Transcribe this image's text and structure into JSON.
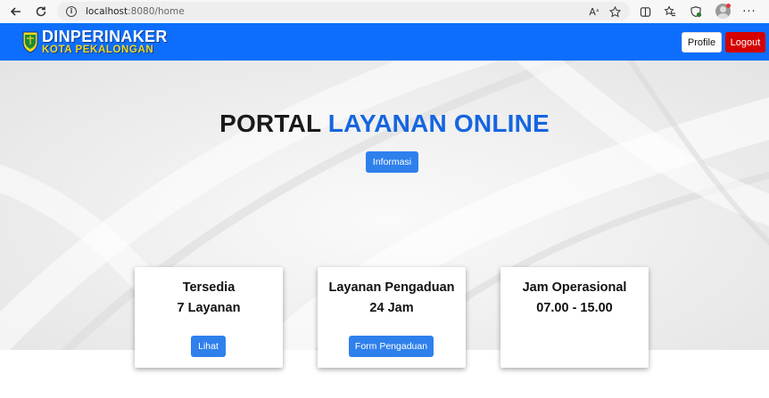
{
  "browser": {
    "url_host": "localhost",
    "url_path": ":8080/home"
  },
  "navbar": {
    "logo_line1": "DINPERINAKER",
    "logo_line2": "KOTA PEKALONGAN",
    "profile_label": "Profile",
    "logout_label": "Logout",
    "brand_color": "#0d6efd",
    "logout_color": "#d50000"
  },
  "hero": {
    "title_part1": "PORTAL",
    "title_part2": "LAYANAN ONLINE",
    "info_button": "Informasi",
    "accent_color": "#1565e0"
  },
  "cards": [
    {
      "title": "Tersedia",
      "value": "7 Layanan",
      "button": "Lihat"
    },
    {
      "title": "Layanan Pengaduan",
      "value": "24 Jam",
      "button": "Form Pengaduan"
    },
    {
      "title": "Jam Operasional",
      "value": "07.00 - 15.00"
    }
  ]
}
